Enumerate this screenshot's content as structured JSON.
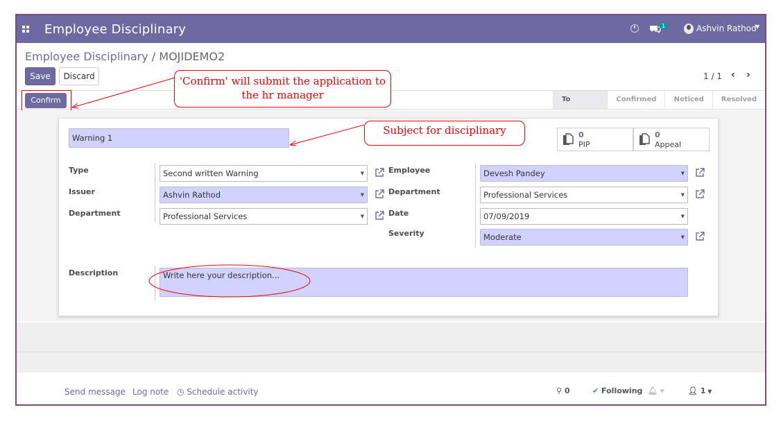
{
  "app": {
    "title": "Employee Disciplinary"
  },
  "topbar": {
    "chat_count": "1",
    "user_name": "Ashvin Rathod"
  },
  "breadcrumb": {
    "parent": "Employee Disciplinary",
    "separator": " / ",
    "current": "MOJIDEMO2"
  },
  "toolbar": {
    "save_label": "Save",
    "discard_label": "Discard",
    "pager": "1 / 1"
  },
  "status": {
    "confirm_label": "Confirm",
    "stages": [
      "To Submit",
      "Confirmed",
      "Noticed",
      "Resolved"
    ],
    "active_stage": "To Submit"
  },
  "form": {
    "subject": "Warning 1",
    "smart_buttons": [
      {
        "count": "0",
        "label": "PIP"
      },
      {
        "count": "0",
        "label": "Appeal"
      }
    ],
    "labels": {
      "type": "Type",
      "issuer": "Issuer",
      "department": "Department",
      "employee": "Employee",
      "department2": "Department",
      "date": "Date",
      "severity": "Severity",
      "description": "Description"
    },
    "values": {
      "type": "Second written Warning",
      "issuer": "Ashvin Rathod",
      "department": "Professional Services",
      "employee": "Devesh Pandey",
      "department2": "Professional Services",
      "date": "07/09/2019",
      "severity": "Moderate"
    },
    "description_placeholder": "Write here your description..."
  },
  "chatter": {
    "send_message": "Send message",
    "log_note": "Log note",
    "schedule_activity": "Schedule activity",
    "attachments": "0",
    "following": "Following",
    "followers": "1"
  },
  "annotations": {
    "confirm_note": "'Confirm' will submit the application to the hr manager",
    "subject_note": "Subject for disciplinary"
  },
  "colors": {
    "brand": "#6d6aa1",
    "required_field": "#d2d2ff",
    "annotation": "#ee0000"
  }
}
